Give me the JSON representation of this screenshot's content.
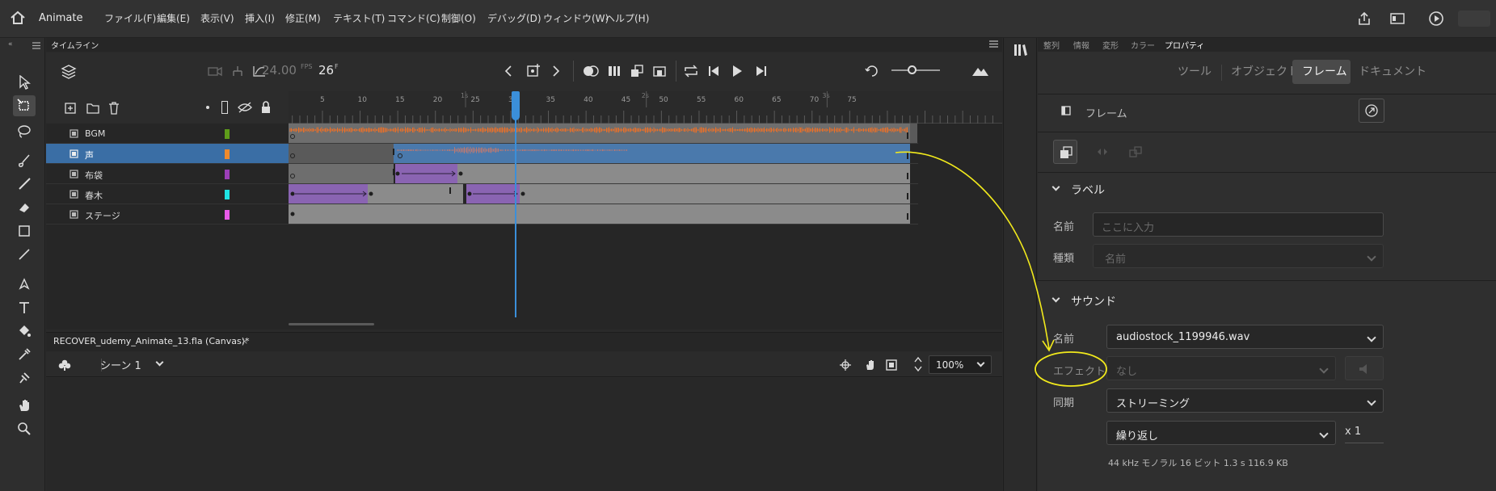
{
  "menubar": {
    "app_name": "Animate",
    "items": [
      "ファイル(F)",
      "編集(E)",
      "表示(V)",
      "挿入(I)",
      "修正(M)",
      "テキスト(T)",
      "コマンド(C)",
      "制御(O)",
      "デバッグ(D)",
      "ウィンドウ(W)",
      "ヘルプ(H)"
    ]
  },
  "timeline": {
    "tab_label": "タイムライン",
    "fps": "24.00",
    "fps_unit": "FPS",
    "current_frame": "26",
    "frame_unit": "F",
    "ruler_ticks": [
      "5",
      "10",
      "15",
      "20",
      "25",
      "30",
      "35",
      "40",
      "45",
      "50",
      "55",
      "60",
      "65",
      "70",
      "75"
    ],
    "seconds_marks": [
      "1s",
      "2s",
      "3s"
    ],
    "layers": [
      {
        "name": "BGM",
        "color": "#5e9c1a",
        "selected": false
      },
      {
        "name": "声",
        "color": "#ef8a2c",
        "selected": true
      },
      {
        "name": "布袋",
        "color": "#9b3fb8",
        "selected": false
      },
      {
        "name": "春木",
        "color": "#1ee3e3",
        "selected": false
      },
      {
        "name": "ステージ",
        "color": "#e85ae8",
        "selected": false
      }
    ]
  },
  "document": {
    "tab_label": "RECOVER_udemy_Animate_13.fla (Canvas)*",
    "scene_label": "シーン 1",
    "zoom": "100%"
  },
  "properties": {
    "tabs": [
      "整列",
      "情報",
      "変形",
      "カラー",
      "プロパティ"
    ],
    "segments": [
      "ツール",
      "オブジェクト",
      "フレーム",
      "ドキュメント"
    ],
    "active_segment": "フレーム",
    "header_label": "フレーム",
    "label_section": {
      "title": "ラベル",
      "name_label": "名前",
      "name_placeholder": "ここに入力",
      "type_label": "種類",
      "type_value": "名前"
    },
    "sound_section": {
      "title": "サウンド",
      "name_label": "名前",
      "name_value": "audiostock_1199946.wav",
      "effect_label": "エフェクト",
      "effect_value": "なし",
      "sync_label": "同期",
      "sync_value": "ストリーミング",
      "repeat_value": "繰り返し",
      "repeat_count": "x 1",
      "info": "44 kHz モノラル 16 ビット 1.3 s 116.9 KB"
    }
  },
  "colors": {
    "accent": "#3a6ea5",
    "playhead": "#3b8fd9",
    "annotation": "#f2ea1c",
    "waveform": "#e8702a"
  }
}
